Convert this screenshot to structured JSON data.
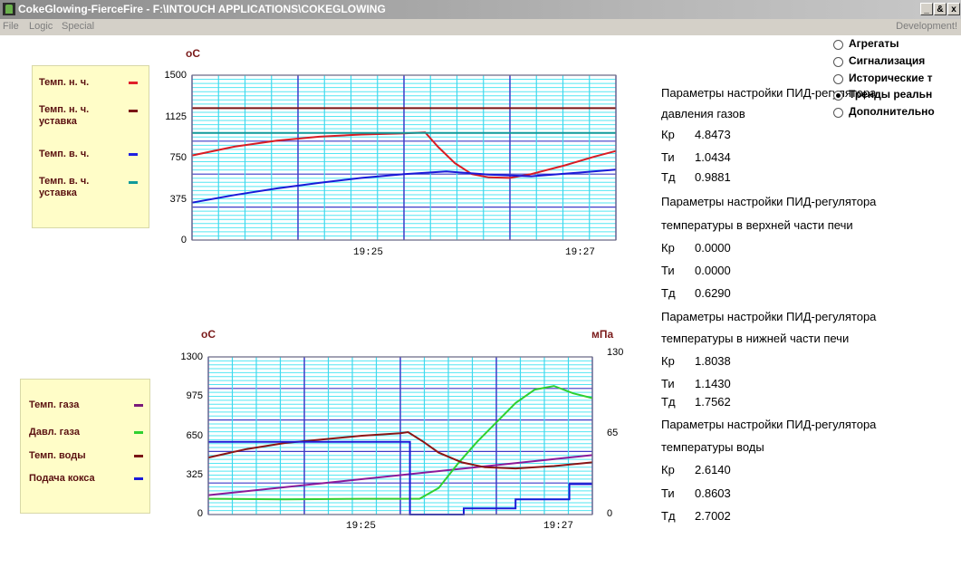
{
  "window": {
    "title": "CokeGlowing-FierceFire - F:\\INTOUCH APPLICATIONS\\COKEGLOWING",
    "minimize": "_",
    "restore": "&",
    "close": "x"
  },
  "menu": {
    "items": [
      "File",
      "Logic",
      "Special"
    ],
    "right": "Development!"
  },
  "chart_data": [
    {
      "type": "line",
      "unit": "оС",
      "ylim": [
        0,
        1500
      ],
      "yticks": [
        "1500",
        "1125",
        "750",
        "375",
        "0"
      ],
      "xticks": [
        "19:25",
        "19:27"
      ],
      "legend": [
        {
          "label": "Темп. н. ч.",
          "color": "#e0202a"
        },
        {
          "label": "Темп. н. ч. уставка",
          "color": "#7a1515"
        },
        {
          "label": "Темп. в. ч.",
          "color": "#2020e0"
        },
        {
          "label": "Темп. в. ч. уставка",
          "color": "#0f9a9a"
        }
      ],
      "series": [
        {
          "name": "Темп. н. ч.",
          "color": "#d81c24",
          "x": [
            0,
            0.1,
            0.2,
            0.3,
            0.4,
            0.5,
            0.55,
            0.58,
            0.62,
            0.66,
            0.7,
            0.75,
            0.8,
            0.88,
            0.95,
            1.0
          ],
          "values": [
            770,
            850,
            905,
            940,
            960,
            970,
            980,
            850,
            700,
            600,
            570,
            565,
            600,
            680,
            760,
            810
          ]
        },
        {
          "name": "Темп. н. ч. уставка",
          "color": "#7a1515",
          "x": [
            0,
            1
          ],
          "values": [
            1200,
            1200
          ]
        },
        {
          "name": "Темп. в. ч.",
          "color": "#1a1ad8",
          "x": [
            0,
            0.1,
            0.2,
            0.3,
            0.4,
            0.5,
            0.6,
            0.7,
            0.8,
            0.9,
            1.0
          ],
          "values": [
            340,
            410,
            470,
            520,
            565,
            600,
            625,
            595,
            580,
            610,
            640
          ]
        },
        {
          "name": "Темп. в. ч. уставка",
          "color": "#0f9a9a",
          "x": [
            0,
            1
          ],
          "values": [
            975,
            975
          ]
        }
      ]
    },
    {
      "type": "line",
      "unit_left": "оС",
      "unit_right": "мПа",
      "ylim": [
        0,
        1300
      ],
      "ylim_right": [
        0,
        130
      ],
      "yticks": [
        "1300",
        "975",
        "650",
        "325",
        "0"
      ],
      "yticks_right": [
        "130",
        "65",
        "0"
      ],
      "xticks": [
        "19:25",
        "19:27"
      ],
      "legend": [
        {
          "label": "Темп. газа",
          "color": "#7a1a7a"
        },
        {
          "label": "Давл. газа",
          "color": "#30d030"
        },
        {
          "label": "Темп. воды",
          "color": "#7a1515"
        },
        {
          "label": "Подача кокса",
          "color": "#1a1ad8"
        }
      ],
      "series": [
        {
          "name": "Темп. газа",
          "color": "#8a1a9a",
          "x": [
            0,
            1
          ],
          "values": [
            160,
            490
          ]
        },
        {
          "name": "Давл. газа",
          "color": "#30d030",
          "x": [
            0,
            0.2,
            0.4,
            0.55,
            0.6,
            0.65,
            0.7,
            0.75,
            0.8,
            0.85,
            0.9,
            0.95,
            1.0
          ],
          "values": [
            130,
            125,
            130,
            130,
            220,
            420,
            600,
            760,
            920,
            1030,
            1060,
            1000,
            960
          ]
        },
        {
          "name": "Темп. воды",
          "color": "#8a1515",
          "x": [
            0,
            0.1,
            0.2,
            0.3,
            0.4,
            0.5,
            0.52,
            0.56,
            0.6,
            0.66,
            0.72,
            0.8,
            0.9,
            1.0
          ],
          "values": [
            470,
            540,
            590,
            620,
            650,
            670,
            680,
            600,
            510,
            430,
            390,
            380,
            400,
            430
          ]
        },
        {
          "name": "Подача кокса",
          "color": "#1a1ad8",
          "step": true,
          "x": [
            0,
            0.525,
            0.525,
            0.665,
            0.665,
            0.8,
            0.8,
            0.94,
            0.94,
            1.0
          ],
          "values": [
            600,
            600,
            0,
            0,
            50,
            50,
            125,
            125,
            250,
            250
          ]
        }
      ]
    }
  ],
  "params": [
    {
      "title1": "Параметры настройки ПИД-регулятора",
      "title2": "давления газов",
      "kp": "4.8473",
      "ti": "1.0434",
      "td": "0.9881"
    },
    {
      "title1": "Параметры настройки ПИД-регулятора",
      "title2": "температуры в верхней части печи",
      "kp": "0.0000",
      "ti": "0.0000",
      "td": "0.6290"
    },
    {
      "title1": "Параметры настройки ПИД-регулятора",
      "title2": "температуры в нижней части печи",
      "kp": "1.8038",
      "ti": "1.1430",
      "td": "1.7562"
    },
    {
      "title1": "Параметры настройки ПИД-регулятора",
      "title2": "температуры воды",
      "kp": "2.6140",
      "ti": "0.8603",
      "td": "2.7002"
    }
  ],
  "param_labels": {
    "kp": "Кр",
    "ti": "Ти",
    "td": "Тд"
  },
  "nav": [
    {
      "label": "Агрегаты",
      "selected": false
    },
    {
      "label": "Сигнализация",
      "selected": false
    },
    {
      "label": "Исторические т",
      "selected": false
    },
    {
      "label": "Тренды реальн",
      "selected": true
    },
    {
      "label": "Дополнительно",
      "selected": false
    }
  ]
}
